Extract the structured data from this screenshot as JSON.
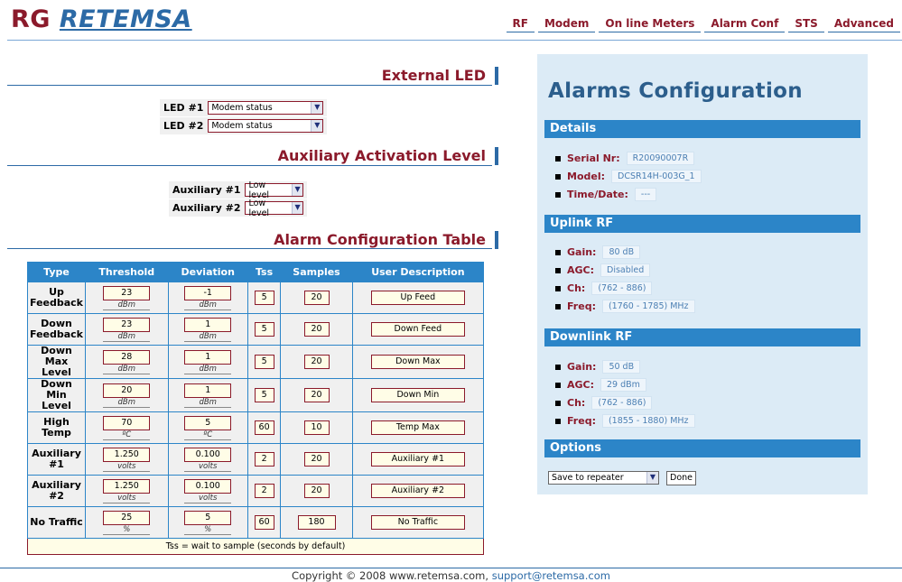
{
  "logo": {
    "rg": "RG",
    "name": "RETEMSA"
  },
  "nav": [
    "RF",
    "Modem",
    "On line Meters",
    "Alarm Conf",
    "STS",
    "Advanced"
  ],
  "external_led": {
    "title": "External LED",
    "rows": [
      {
        "label": "LED #1",
        "value": "Modem status"
      },
      {
        "label": "LED #2",
        "value": "Modem status"
      }
    ]
  },
  "aux_activation": {
    "title": "Auxiliary Activation Level",
    "rows": [
      {
        "label": "Auxiliary #1",
        "value": "Low level"
      },
      {
        "label": "Auxiliary #2",
        "value": "Low level"
      }
    ]
  },
  "alarm_table": {
    "title": "Alarm Configuration Table",
    "headers": [
      "Type",
      "Threshold",
      "Deviation",
      "Tss",
      "Samples",
      "User Description"
    ],
    "rows": [
      {
        "type": "Up Feedback",
        "threshold": "23",
        "threshold_unit": "dBm",
        "deviation": "-1",
        "deviation_unit": "dBm",
        "tss": "5",
        "samples": "20",
        "description": "Up Feed"
      },
      {
        "type": "Down Feedback",
        "threshold": "23",
        "threshold_unit": "dBm",
        "deviation": "1",
        "deviation_unit": "dBm",
        "tss": "5",
        "samples": "20",
        "description": "Down Feed"
      },
      {
        "type": "Down Max Level",
        "threshold": "28",
        "threshold_unit": "dBm",
        "deviation": "1",
        "deviation_unit": "dBm",
        "tss": "5",
        "samples": "20",
        "description": "Down Max"
      },
      {
        "type": "Down Min Level",
        "threshold": "20",
        "threshold_unit": "dBm",
        "deviation": "1",
        "deviation_unit": "dBm",
        "tss": "5",
        "samples": "20",
        "description": "Down Min"
      },
      {
        "type": "High Temp",
        "threshold": "70",
        "threshold_unit": "ºC",
        "deviation": "5",
        "deviation_unit": "ºC",
        "tss": "60",
        "samples": "10",
        "description": "Temp Max"
      },
      {
        "type": "Auxiliary #1",
        "threshold": "1.250",
        "threshold_unit": "volts",
        "deviation": "0.100",
        "deviation_unit": "volts",
        "tss": "2",
        "samples": "20",
        "description": "Auxiliary #1"
      },
      {
        "type": "Auxiliary #2",
        "threshold": "1.250",
        "threshold_unit": "volts",
        "deviation": "0.100",
        "deviation_unit": "volts",
        "tss": "2",
        "samples": "20",
        "description": "Auxiliary #2"
      },
      {
        "type": "No Traffic",
        "threshold": "25",
        "threshold_unit": "%",
        "deviation": "5",
        "deviation_unit": "%",
        "tss": "60",
        "samples": "180",
        "description": "No Traffic"
      }
    ],
    "footnote": "Tss = wait to sample (seconds by default)"
  },
  "panel": {
    "title": "Alarms Configuration",
    "details": {
      "header": "Details",
      "items": [
        {
          "key": "Serial Nr:",
          "value": "R20090007R"
        },
        {
          "key": "Model:",
          "value": "DCSR14H-003G_1"
        },
        {
          "key": "Time/Date:",
          "value": "---"
        }
      ]
    },
    "uplink": {
      "header": "Uplink RF",
      "items": [
        {
          "key": "Gain:",
          "value": "80 dB"
        },
        {
          "key": "AGC:",
          "value": "Disabled"
        },
        {
          "key": "Ch:",
          "value": "(762 - 886)"
        },
        {
          "key": "Freq:",
          "value": "(1760 - 1785) MHz"
        }
      ]
    },
    "downlink": {
      "header": "Downlink RF",
      "items": [
        {
          "key": "Gain:",
          "value": "50 dB"
        },
        {
          "key": "AGC:",
          "value": "29 dBm"
        },
        {
          "key": "Ch:",
          "value": "(762 - 886)"
        },
        {
          "key": "Freq:",
          "value": "(1855 - 1880) MHz"
        }
      ]
    },
    "options": {
      "header": "Options",
      "select_value": "Save to repeater",
      "done_label": "Done"
    }
  },
  "footer": {
    "copyright": "Copyright © 2008 www.retemsa.com,",
    "email": "support@retemsa.com"
  },
  "colors": {
    "brand_red": "#8b1a2b",
    "brand_blue": "#2c85c8",
    "panel_bg": "#dcebf6"
  }
}
